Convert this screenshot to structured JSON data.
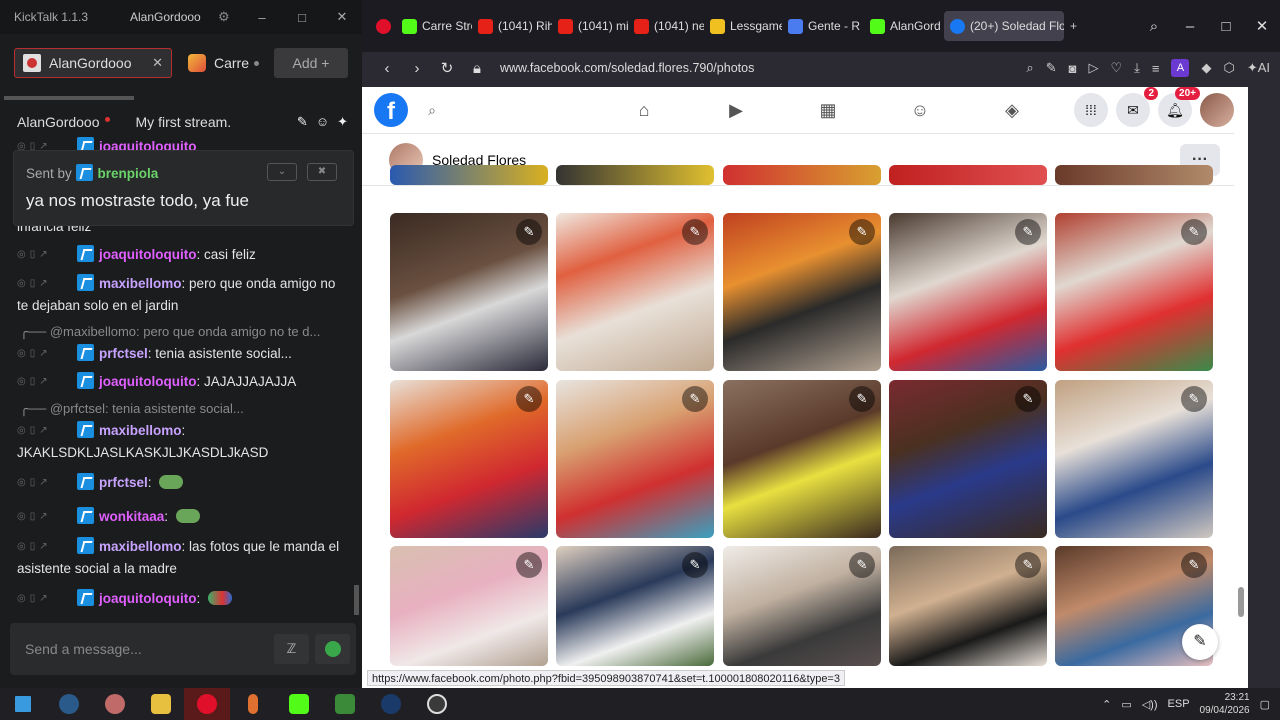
{
  "kicktalk": {
    "app_title": "KickTalk 1.1.3",
    "user": "AlanGordooo",
    "tabs": [
      {
        "label": "AlanGordooo"
      },
      {
        "label": "Carre"
      }
    ],
    "add_label": "Add +",
    "channel": "AlanGordooo",
    "stream_title": "My first stream.",
    "pinned": {
      "sent_by": "Sent by",
      "user": "brenpiola",
      "text": "ya nos mostraste todo, ya fue"
    },
    "messages": [
      {
        "user": "joaquitoloquito",
        "text": ""
      },
      {
        "user": "",
        "text": "infancia feliz"
      },
      {
        "user": "joaquitoloquito",
        "text": "casi feliz"
      },
      {
        "user": "maxibellomo",
        "text": "pero que onda amigo no te dejaban solo en el jardin"
      },
      {
        "reply": "@maxibellomo: pero que onda amigo no te d..."
      },
      {
        "user": "prfctsel",
        "text": "tenia asistente social..."
      },
      {
        "user": "joaquitoloquito",
        "text": "JAJAJJAJAJJA"
      },
      {
        "reply": "@prfctsel: tenia asistente social..."
      },
      {
        "user": "maxibellomo",
        "text": "JKAKLSDKLJASLKASKJLJKASDLJkASD"
      },
      {
        "user": "prfctsel",
        "text": ""
      },
      {
        "user": "wonkitaaa",
        "text": ""
      },
      {
        "user": "maxibellomo",
        "text": "las fotos que le manda el asistente social a la madre"
      },
      {
        "user": "joaquitoloquito",
        "text": ""
      }
    ],
    "input_placeholder": "Send a message..."
  },
  "browser": {
    "tabs": [
      {
        "label": "Carre Stre"
      },
      {
        "label": "(1041) Rih"
      },
      {
        "label": "(1041) mi"
      },
      {
        "label": "(1041) ne"
      },
      {
        "label": "Lessgame"
      },
      {
        "label": "Gente - R"
      },
      {
        "label": "AlanGord"
      },
      {
        "label": "(20+) Soledad Flo"
      }
    ],
    "url": "www.facebook.com/soledad.flores.790/photos",
    "status_url": "https://www.facebook.com/photo.php?fbid=395098903870741&set=t.100001808020116&type=3"
  },
  "facebook": {
    "logo": "f",
    "messenger_count": "2",
    "notif_count": "20+",
    "profile_name": "Soledad Flores",
    "more": "···"
  },
  "taskbar": {
    "lang": "ESP",
    "time": "23:21",
    "date": "09/04/2026"
  },
  "colors": {
    "fb_blue": "#1877f2",
    "badge_red": "#e41e3f",
    "kick_green": "#53fc18"
  }
}
